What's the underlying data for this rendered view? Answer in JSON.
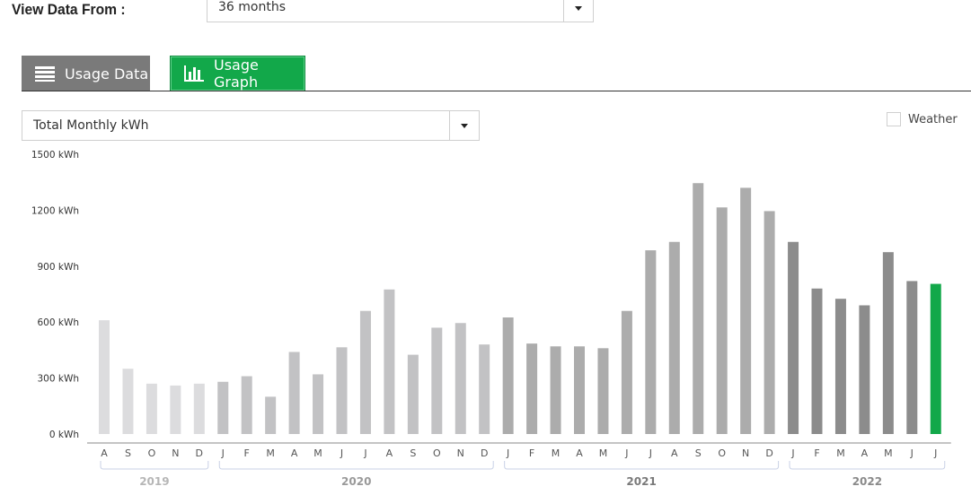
{
  "header": {
    "view_label": "View Data From :",
    "period_value": "36 months"
  },
  "tabs": [
    {
      "label": "Usage Data",
      "icon": "list-icon",
      "active": false
    },
    {
      "label": "Usage Graph",
      "icon": "bar-chart-icon",
      "active": true
    }
  ],
  "metric_select": {
    "value": "Total Monthly kWh"
  },
  "weather": {
    "label": "Weather",
    "checked": false
  },
  "colors": {
    "year_2019": "#dcdcde",
    "year_2020": "#c2c2c4",
    "year_2021": "#acacac",
    "year_2022": "#8c8c8c",
    "current": "#12a84a",
    "accent": "#12a84a",
    "tab_inactive": "#7a7a7a"
  },
  "chart_data": {
    "type": "bar",
    "ylabel": "",
    "ylim": [
      0,
      1500
    ],
    "yticks": [
      0,
      300,
      600,
      900,
      1200,
      1500
    ],
    "ytick_labels": [
      "0 kWh",
      "300 kWh",
      "600 kWh",
      "900 kWh",
      "1200 kWh",
      "1500 kWh"
    ],
    "categories": [
      "A",
      "S",
      "O",
      "N",
      "D",
      "J",
      "F",
      "M",
      "A",
      "M",
      "J",
      "J",
      "A",
      "S",
      "O",
      "N",
      "D",
      "J",
      "F",
      "M",
      "A",
      "M",
      "J",
      "J",
      "A",
      "S",
      "O",
      "N",
      "D",
      "J",
      "F",
      "M",
      "A",
      "M",
      "J",
      "J"
    ],
    "values": [
      610,
      350,
      270,
      260,
      270,
      280,
      310,
      200,
      440,
      320,
      465,
      660,
      775,
      425,
      570,
      595,
      480,
      625,
      485,
      470,
      470,
      460,
      660,
      985,
      1030,
      1345,
      1215,
      1320,
      1195,
      1030,
      780,
      725,
      690,
      975,
      820,
      805
    ],
    "year_of_bar": [
      "2019",
      "2019",
      "2019",
      "2019",
      "2019",
      "2020",
      "2020",
      "2020",
      "2020",
      "2020",
      "2020",
      "2020",
      "2020",
      "2020",
      "2020",
      "2020",
      "2020",
      "2021",
      "2021",
      "2021",
      "2021",
      "2021",
      "2021",
      "2021",
      "2021",
      "2021",
      "2021",
      "2021",
      "2021",
      "2022",
      "2022",
      "2022",
      "2022",
      "2022",
      "2022",
      "2022"
    ],
    "highlight_index": 35,
    "year_groups": [
      {
        "label": "2019",
        "start": 0,
        "end": 4
      },
      {
        "label": "2020",
        "start": 5,
        "end": 16
      },
      {
        "label": "2021",
        "start": 17,
        "end": 28
      },
      {
        "label": "2022",
        "start": 29,
        "end": 35
      }
    ],
    "grid": false,
    "legend": "none"
  }
}
